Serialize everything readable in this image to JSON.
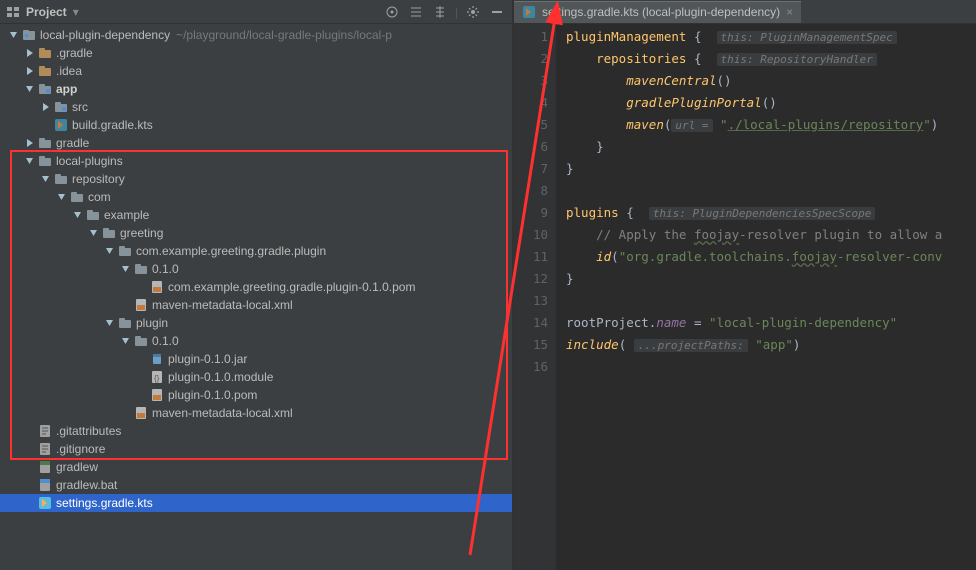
{
  "sidebar": {
    "header": {
      "title": "Project"
    },
    "rows": [
      {
        "i": 0,
        "a": "open",
        "t": "root",
        "label": "local-plugin-dependency",
        "path": "~/playground/local-gradle-plugins/local-p"
      },
      {
        "i": 1,
        "a": "closed",
        "t": "folder-dim",
        "label": ".gradle"
      },
      {
        "i": 1,
        "a": "closed",
        "t": "folder-dim",
        "label": ".idea"
      },
      {
        "i": 1,
        "a": "open",
        "t": "folder-mod",
        "label": "app",
        "bold": true
      },
      {
        "i": 2,
        "a": "closed",
        "t": "folder-mod",
        "label": "src"
      },
      {
        "i": 2,
        "a": "none",
        "t": "kts",
        "label": "build.gradle.kts"
      },
      {
        "i": 1,
        "a": "closed",
        "t": "folder",
        "label": "gradle"
      },
      {
        "i": 1,
        "a": "open",
        "t": "folder",
        "label": "local-plugins"
      },
      {
        "i": 2,
        "a": "open",
        "t": "folder",
        "label": "repository"
      },
      {
        "i": 3,
        "a": "open",
        "t": "folder",
        "label": "com"
      },
      {
        "i": 4,
        "a": "open",
        "t": "folder",
        "label": "example"
      },
      {
        "i": 5,
        "a": "open",
        "t": "folder",
        "label": "greeting"
      },
      {
        "i": 6,
        "a": "open",
        "t": "folder",
        "label": "com.example.greeting.gradle.plugin"
      },
      {
        "i": 7,
        "a": "open",
        "t": "folder",
        "label": "0.1.0"
      },
      {
        "i": 8,
        "a": "none",
        "t": "xml",
        "label": "com.example.greeting.gradle.plugin-0.1.0.pom"
      },
      {
        "i": 7,
        "a": "none",
        "t": "xml",
        "label": "maven-metadata-local.xml"
      },
      {
        "i": 6,
        "a": "open",
        "t": "folder",
        "label": "plugin"
      },
      {
        "i": 7,
        "a": "open",
        "t": "folder",
        "label": "0.1.0"
      },
      {
        "i": 8,
        "a": "none",
        "t": "jar",
        "label": "plugin-0.1.0.jar"
      },
      {
        "i": 8,
        "a": "none",
        "t": "json",
        "label": "plugin-0.1.0.module"
      },
      {
        "i": 8,
        "a": "none",
        "t": "xml",
        "label": "plugin-0.1.0.pom"
      },
      {
        "i": 7,
        "a": "none",
        "t": "xml",
        "label": "maven-metadata-local.xml"
      },
      {
        "i": 1,
        "a": "none",
        "t": "txt",
        "label": ".gitattributes"
      },
      {
        "i": 1,
        "a": "none",
        "t": "txt",
        "label": ".gitignore"
      },
      {
        "i": 1,
        "a": "none",
        "t": "sh",
        "label": "gradlew"
      },
      {
        "i": 1,
        "a": "none",
        "t": "bat",
        "label": "gradlew.bat"
      },
      {
        "i": 1,
        "a": "none",
        "t": "kts",
        "label": "settings.gradle.kts",
        "selected": true
      }
    ]
  },
  "editor": {
    "tab": {
      "label": "settings.gradle.kts (local-plugin-dependency)"
    },
    "lines": [
      {
        "n": 1,
        "html": "<span class='fn2'>pluginManagement</span> <span class='id'>{</span>  <span class='hint'>this: PluginManagementSpec</span>"
      },
      {
        "n": 2,
        "html": "    <span class='fn2'>repositories</span> <span class='id'>{</span>  <span class='hint'>this: RepositoryHandler</span>"
      },
      {
        "n": 3,
        "html": "        <span class='fn'>mavenCentral</span><span class='id'>()</span>"
      },
      {
        "n": 4,
        "html": "        <span class='fn'>gradlePluginPortal</span><span class='id'>()</span>"
      },
      {
        "n": 5,
        "html": "        <span class='fn'>maven</span><span class='id'>(</span><span class='hint'>url =</span> <span class='str'>\"</span><span class='str-u'>./local-plugins/repository</span><span class='str'>\"</span><span class='id'>)</span>"
      },
      {
        "n": 6,
        "html": "    <span class='id'>}</span>"
      },
      {
        "n": 7,
        "html": "<span class='id'>}</span>"
      },
      {
        "n": 8,
        "html": ""
      },
      {
        "n": 9,
        "html": "<span class='fn2'>plugins</span> <span class='id'>{</span>  <span class='hint'>this: PluginDependenciesSpecScope</span>"
      },
      {
        "n": 10,
        "html": "    <span class='com'>// Apply the </span><span class='com' style='text-decoration:underline wavy #5e6b4c'>foojay</span><span class='com'>-resolver plugin to allow a</span>"
      },
      {
        "n": 11,
        "html": "    <span class='fn'>id</span><span class='id'>(</span><span class='str'>\"org.gradle.toolchains.</span><span class='str' style='text-decoration:underline wavy #5e6b4c'>foojay</span><span class='str'>-resolver-conv</span>"
      },
      {
        "n": 12,
        "html": "<span class='id'>}</span>"
      },
      {
        "n": 13,
        "html": ""
      },
      {
        "n": 14,
        "html": "<span class='id'>rootProject</span><span class='id'>.</span><span class='prop'>name</span> <span class='id'>= </span><span class='str'>\"local-plugin-dependency\"</span>"
      },
      {
        "n": 15,
        "html": "<span class='fn'>include</span><span class='id'>(</span> <span class='hint'>...projectPaths:</span> <span class='str'>\"app\"</span><span class='id'>)</span>"
      },
      {
        "n": 16,
        "html": ""
      }
    ]
  }
}
